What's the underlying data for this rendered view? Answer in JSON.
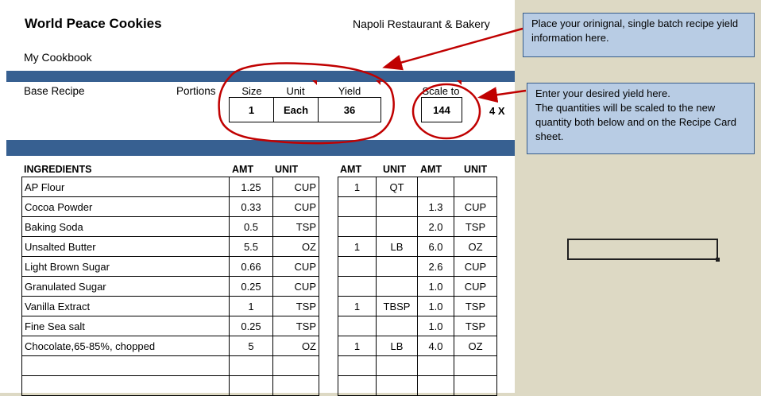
{
  "sheet": {
    "title": "World Peace Cookies",
    "restaurant": "Napoli Restaurant & Bakery",
    "cookbook": "My Cookbook"
  },
  "recipe_header": {
    "base_label": "Base Recipe",
    "portions_label": "Portions",
    "size_label": "Size",
    "unit_label": "Unit",
    "yield_label": "Yield",
    "scale_label": "Scale to",
    "size_value": "1",
    "unit_value": "Each",
    "yield_value": "36",
    "scale_value": "144",
    "multiplier": "4 X"
  },
  "columns": {
    "ingredients": "INGREDIENTS",
    "amt": "AMT",
    "unit": "UNIT",
    "amt2": "AMT",
    "unit2": "UNIT",
    "amt3": "AMT",
    "unit3": "UNIT"
  },
  "ingredients": [
    {
      "name": "AP Flour",
      "amt": "1.25",
      "unit": "CUP",
      "amt2": "1",
      "unit2": "QT",
      "amt3": "",
      "unit3": ""
    },
    {
      "name": "Cocoa Powder",
      "amt": "0.33",
      "unit": "CUP",
      "amt2": "",
      "unit2": "",
      "amt3": "1.3",
      "unit3": "CUP"
    },
    {
      "name": "Baking Soda",
      "amt": "0.5",
      "unit": "TSP",
      "amt2": "",
      "unit2": "",
      "amt3": "2.0",
      "unit3": "TSP"
    },
    {
      "name": "Unsalted Butter",
      "amt": "5.5",
      "unit": "OZ",
      "amt2": "1",
      "unit2": "LB",
      "amt3": "6.0",
      "unit3": "OZ"
    },
    {
      "name": "Light Brown Sugar",
      "amt": "0.66",
      "unit": "CUP",
      "amt2": "",
      "unit2": "",
      "amt3": "2.6",
      "unit3": "CUP"
    },
    {
      "name": "Granulated Sugar",
      "amt": "0.25",
      "unit": "CUP",
      "amt2": "",
      "unit2": "",
      "amt3": "1.0",
      "unit3": "CUP"
    },
    {
      "name": "Vanilla Extract",
      "amt": "1",
      "unit": "TSP",
      "amt2": "1",
      "unit2": "TBSP",
      "amt3": "1.0",
      "unit3": "TSP"
    },
    {
      "name": "Fine Sea salt",
      "amt": "0.25",
      "unit": "TSP",
      "amt2": "",
      "unit2": "",
      "amt3": "1.0",
      "unit3": "TSP"
    },
    {
      "name": "Chocolate,65-85%, chopped",
      "amt": "5",
      "unit": "OZ",
      "amt2": "1",
      "unit2": "LB",
      "amt3": "4.0",
      "unit3": "OZ"
    },
    {
      "name": "",
      "amt": "",
      "unit": "",
      "amt2": "",
      "unit2": "",
      "amt3": "",
      "unit3": ""
    },
    {
      "name": "",
      "amt": "",
      "unit": "",
      "amt2": "",
      "unit2": "",
      "amt3": "",
      "unit3": ""
    }
  ],
  "callouts": {
    "yield_note": "Place your orinignal, single batch recipe yield information here.",
    "scale_note_line1": "Enter your desired yield here.",
    "scale_note_line2": "The quantities will be scaled to the new quantity both below and on the Recipe Card sheet."
  },
  "colors": {
    "header_bar": "#376091",
    "annotation_red": "#c00000",
    "callout_bg": "#b8cce4",
    "page_bg": "#ddd9c4"
  }
}
